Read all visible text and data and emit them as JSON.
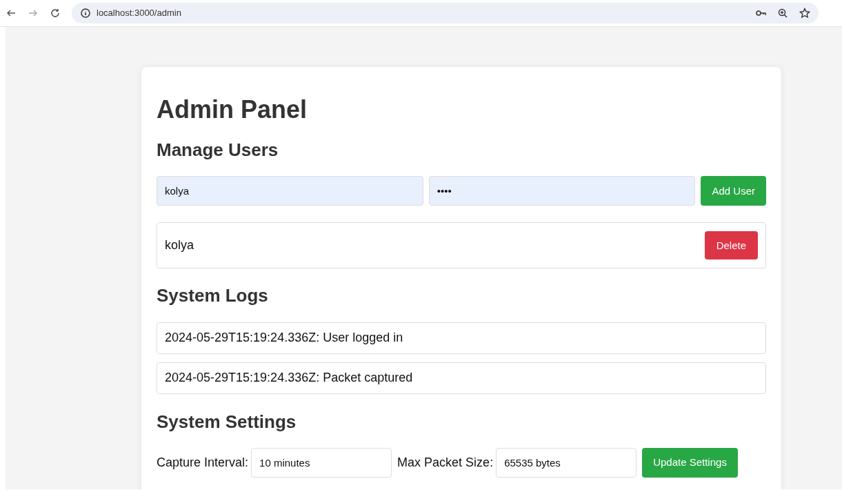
{
  "browser": {
    "url": "localhost:3000/admin"
  },
  "title": "Admin Panel",
  "users_section": {
    "heading": "Manage Users",
    "username_field": {
      "value": "kolya"
    },
    "password_field": {
      "value": "••••"
    },
    "add_button": "Add User",
    "users": [
      {
        "name": "kolya",
        "delete_button": "Delete"
      }
    ]
  },
  "logs_section": {
    "heading": "System Logs",
    "logs": [
      "2024-05-29T15:19:24.336Z: User logged in",
      "2024-05-29T15:19:24.336Z: Packet captured"
    ]
  },
  "settings_section": {
    "heading": "System Settings",
    "fields": [
      {
        "label": "Capture Interval:",
        "value": "10 minutes"
      },
      {
        "label": "Max Packet Size:",
        "value": "65535 bytes"
      }
    ],
    "update_button": "Update Settings"
  }
}
